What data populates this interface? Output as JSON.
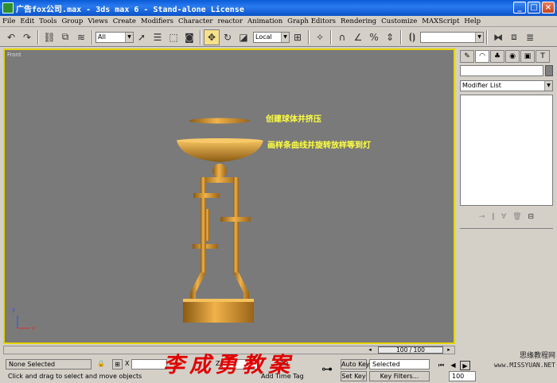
{
  "window": {
    "title": "广告fox公司.max - 3ds max 6 - Stand-alone License",
    "minimize": "_",
    "maximize": "□",
    "close": "×"
  },
  "menu": [
    "File",
    "Edit",
    "Tools",
    "Group",
    "Views",
    "Create",
    "Modifiers",
    "Character",
    "reactor",
    "Animation",
    "Graph Editors",
    "Rendering",
    "Customize",
    "MAXScript",
    "Help"
  ],
  "toolbar": {
    "selection_filter": "All",
    "reference_coord": "Local",
    "named_selection": ""
  },
  "viewport": {
    "label": "Front",
    "annotation_top": "创建球体并挤压",
    "annotation_mid": "画样条曲线并旋转放样等到灯",
    "axis_x": "x",
    "axis_y": "y"
  },
  "command_panel": {
    "object_name": "",
    "modifier_list": "Modifier List"
  },
  "timeline": {
    "frame_display": "100 / 100",
    "current_frame": 100,
    "total_frames": 100
  },
  "status": {
    "selection": "None Selected",
    "prompt": "Click and drag to select and move objects",
    "x_label": "X",
    "z_label": "Z",
    "z_value": "29",
    "add_time_tag": "Add Time Tag",
    "auto_key": "Auto Key",
    "set_key": "Set Key",
    "key_mode": "Selected",
    "key_filters": "Key Filters...",
    "frame_field": "100"
  },
  "watermark": "李成勇教案",
  "site": {
    "name": "思缘教程网",
    "url": "www.MISSYUAN.NET"
  },
  "colors": {
    "viewport_bg": "#7a7a7a",
    "active_border": "#e6d400",
    "annotation": "#ffff40",
    "model": "#d99a3c",
    "watermark": "#e00000"
  }
}
